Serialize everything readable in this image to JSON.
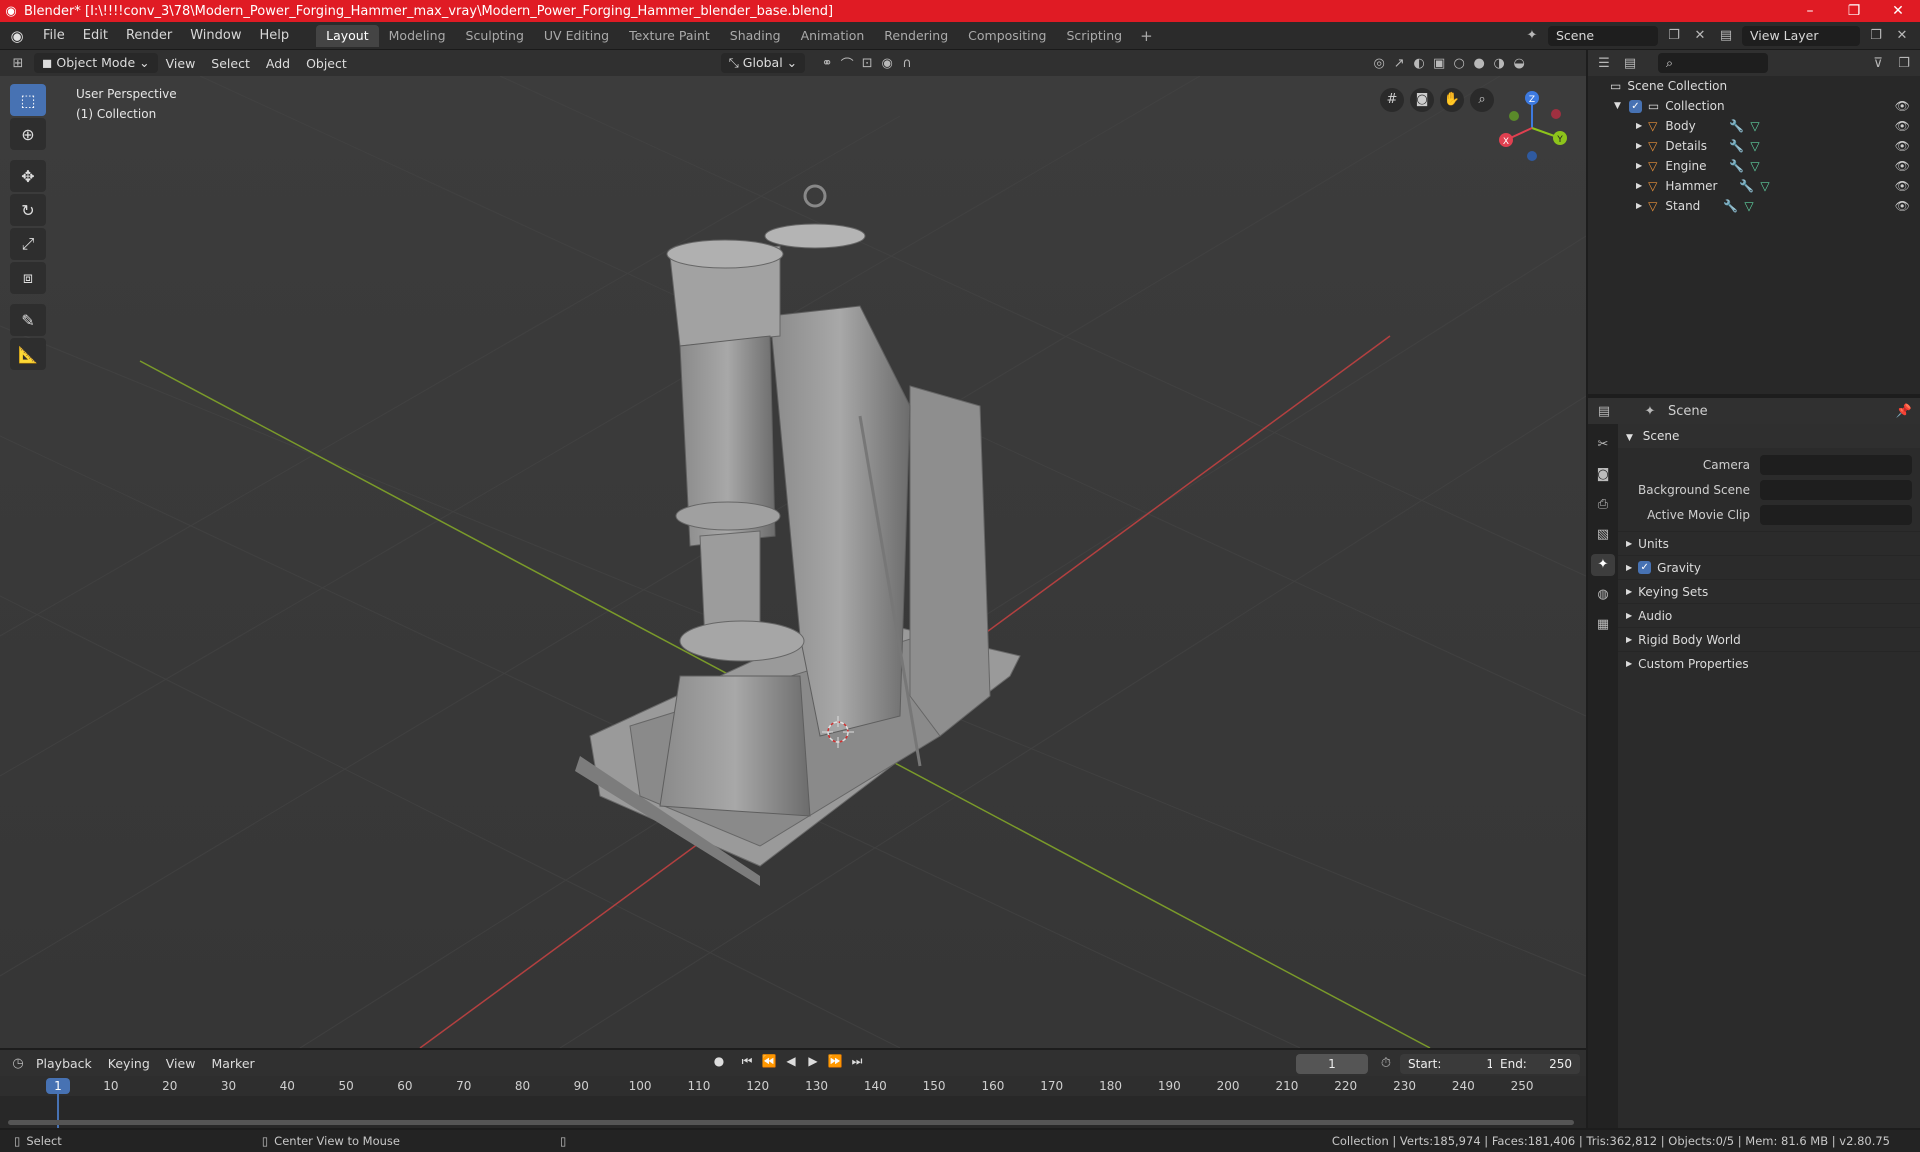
{
  "window": {
    "title": "Blender* [I:\\!!!!conv_3\\78\\Modern_Power_Forging_Hammer_max_vray\\Modern_Power_Forging_Hammer_blender_base.blend]",
    "minimize": "–",
    "maximize": "❐",
    "close": "✕"
  },
  "menubar": {
    "items": [
      "File",
      "Edit",
      "Render",
      "Window",
      "Help"
    ],
    "workspaces": [
      "Layout",
      "Modeling",
      "Sculpting",
      "UV Editing",
      "Texture Paint",
      "Shading",
      "Animation",
      "Rendering",
      "Compositing",
      "Scripting"
    ],
    "active_workspace": "Layout",
    "add_tab": "+",
    "scene": "Scene",
    "view_layer": "View Layer"
  },
  "viewport": {
    "mode": "Object Mode",
    "menus": [
      "View",
      "Select",
      "Add",
      "Object"
    ],
    "orientation": "Global",
    "perspective": "User Perspective",
    "collection": "(1) Collection",
    "gizmo": {
      "x": "X",
      "y": "Y",
      "z": "Z"
    }
  },
  "outliner": {
    "search_placeholder": "",
    "root": "Scene Collection",
    "collection": "Collection",
    "objects": [
      "Body",
      "Details",
      "Engine",
      "Hammer",
      "Stand"
    ]
  },
  "properties": {
    "context": "Scene",
    "panel": "Scene",
    "rows": [
      {
        "label": "Camera",
        "value": ""
      },
      {
        "label": "Background Scene",
        "value": ""
      },
      {
        "label": "Active Movie Clip",
        "value": ""
      }
    ],
    "subpanels": [
      "Units",
      "Gravity",
      "Keying Sets",
      "Audio",
      "Rigid Body World",
      "Custom Properties"
    ],
    "gravity_checked": true
  },
  "timeline": {
    "menus": [
      "Playback",
      "Keying",
      "View",
      "Marker"
    ],
    "current_frame": "1",
    "start_label": "Start:",
    "start": "1",
    "end_label": "End:",
    "end": "250",
    "ticks": [
      "1",
      "10",
      "20",
      "30",
      "40",
      "50",
      "60",
      "70",
      "80",
      "90",
      "100",
      "110",
      "120",
      "130",
      "140",
      "150",
      "160",
      "170",
      "180",
      "190",
      "200",
      "210",
      "220",
      "230",
      "240",
      "250"
    ]
  },
  "statusbar": {
    "select": "Select",
    "center_view": "Center View to Mouse",
    "stats": "Collection | Verts:185,974 | Faces:181,406 | Tris:362,812 | Objects:0/5 | Mem: 81.6 MB | v2.80.75"
  }
}
